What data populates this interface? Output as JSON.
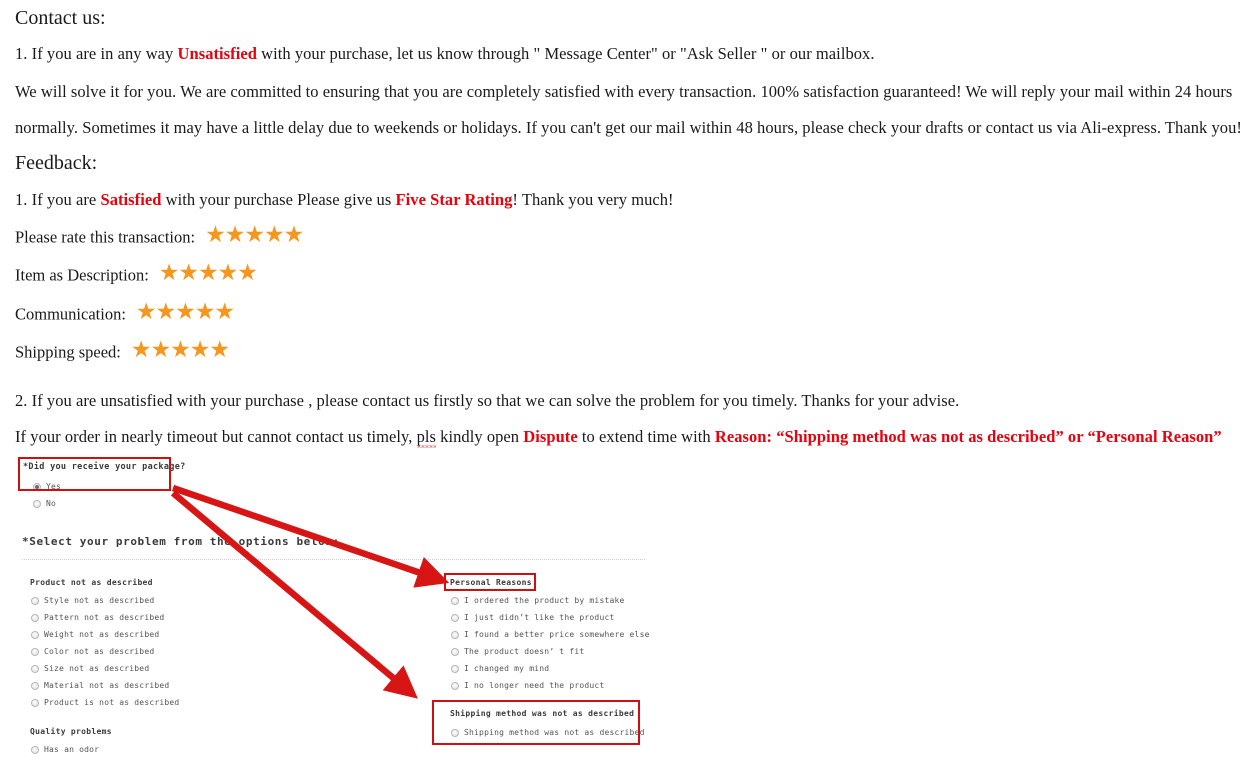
{
  "document": {
    "contact_heading": "Contact us:",
    "contact_item_1_a": "1.  If you are in any way ",
    "contact_item_1_highlight": "Unsatisfied",
    "contact_item_1_b": " with your purchase, let us know through \" Message Center\" or \"Ask Seller \" or our mailbox.",
    "contact_para_2": "We will solve it for you. We are committed to ensuring that you are completely satisfied with every transaction. 100% satisfaction guaranteed!    We will reply your mail within 24 hours",
    "contact_para_3": "normally. Sometimes it may have a little delay due to weekends or holidays. If you can't get our mail within 48 hours, please check your drafts or contact us via Ali-express. Thank you!",
    "feedback_heading": "Feedback:",
    "feedback_item_1_a": "1.  If you are ",
    "feedback_item_1_highlight_1": "Satisfied",
    "feedback_item_1_b": " with your purchase Please give us ",
    "feedback_item_1_highlight_2": "Five Star Rating",
    "feedback_item_1_c": "! Thank you very much!",
    "unsatisfied_para": "2.  If you are unsatisfied with your purchase , please contact us firstly so that we can solve the problem  for you timely. Thanks for your advise.",
    "dispute_para_a": "If your order in nearly timeout but cannot contact us timely, ",
    "dispute_para_misspelled": "pls",
    "dispute_para_b": " kindly open ",
    "dispute_word": "Dispute",
    "dispute_para_c": " to extend time with ",
    "dispute_reason": "Reason: “Shipping method was not as described” or “Personal Reason”"
  },
  "ratings": {
    "star_glyph": "★",
    "star_color": "#f5961e",
    "rows": [
      {
        "label": "Please rate this transaction:",
        "stars": 5
      },
      {
        "label": "Item as Description:",
        "stars": 5
      },
      {
        "label": "Communication:",
        "stars": 5
      },
      {
        "label": "Shipping speed:",
        "stars": 5
      }
    ]
  },
  "dispute_form": {
    "question": "*Did you receive your package?",
    "question_answers": [
      {
        "label": "Yes",
        "selected": true
      },
      {
        "label": "No",
        "selected": false
      }
    ],
    "select_prompt": "*Select your problem from the options below:",
    "left_column": [
      {
        "title": "Product not as described",
        "options": [
          "Style not as described",
          "Pattern not as described",
          "Weight not as described",
          "Color not as described",
          "Size not as described",
          "Material not as described",
          "Product is not as described"
        ]
      },
      {
        "title": "Quality problems",
        "options": [
          "Has an odor"
        ]
      }
    ],
    "right_column": [
      {
        "title": "Personal Reasons",
        "options": [
          "I ordered the product by mistake",
          "I just didn’t like the product",
          "I found a better price somewhere else",
          "The product doesn’ t fit",
          "I changed my mind",
          "I no longer need the product"
        ]
      },
      {
        "title": "Shipping method was not as described",
        "options": [
          "Shipping method was not as described"
        ]
      }
    ]
  },
  "annotations": {
    "highlight_color": "#cf1010",
    "arrow_color": "#d81515",
    "boxes": [
      "did-you-receive-package",
      "personal-reasons",
      "shipping-method-not-as-described"
    ]
  }
}
